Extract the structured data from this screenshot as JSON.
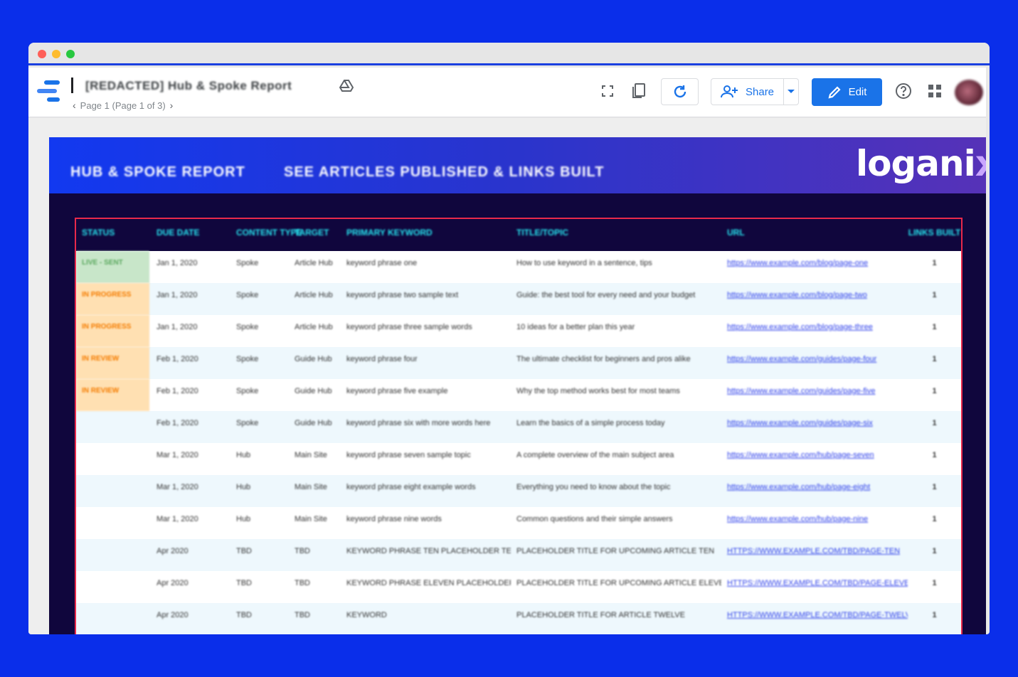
{
  "window": {
    "doc_title": "[REDACTED] Hub & Spoke Report",
    "page_indicator": "Page 1 (Page 1 of 3)"
  },
  "toolbar": {
    "share_label": "Share",
    "edit_label": "Edit"
  },
  "icons": {
    "app_logo": "data-studio-logo",
    "drive": "google-drive-icon",
    "fullscreen": "fullscreen-icon",
    "copy": "copy-icon",
    "refresh": "refresh-icon",
    "share": "person-add-icon",
    "share_dropdown": "caret-down-icon",
    "edit": "pencil-icon",
    "help": "help-icon",
    "apps": "apps-grid-icon"
  },
  "colors": {
    "accent": "#1a73e8",
    "report_bg": "#10063d",
    "header_cyan": "#27e6f0",
    "table_border": "#e8294b",
    "status_green": "#c8e6c9",
    "status_orange": "#ffe0b2"
  },
  "report": {
    "title": "HUB & SPOKE REPORT",
    "subtitle": "SEE ARTICLES PUBLISHED & LINKS BUILT",
    "brand_main": "logani",
    "brand_x": "x",
    "columns": [
      "STATUS",
      "DUE DATE",
      "CONTENT TYPE",
      "TARGET",
      "PRIMARY KEYWORD",
      "TITLE/TOPIC",
      "URL",
      "LINKS BUILT"
    ],
    "rows": [
      {
        "status": "LIVE - SENT",
        "status_type": "green",
        "date": "Jan 1, 2020",
        "type": "Spoke",
        "target": "Article Hub",
        "keyword": "keyword phrase one",
        "title": "How to use keyword in a sentence, tips",
        "url": "https://www.example.com/blog/page-one",
        "links": "1"
      },
      {
        "status": "IN PROGRESS",
        "status_type": "orange",
        "date": "Jan 1, 2020",
        "type": "Spoke",
        "target": "Article Hub",
        "keyword": "keyword phrase two sample text",
        "title": "Guide: the best tool for every need and your budget",
        "url": "https://www.example.com/blog/page-two",
        "links": "1"
      },
      {
        "status": "IN PROGRESS",
        "status_type": "orange",
        "date": "Jan 1, 2020",
        "type": "Spoke",
        "target": "Article Hub",
        "keyword": "keyword phrase three sample words",
        "title": "10 ideas for a better plan this year",
        "url": "https://www.example.com/blog/page-three",
        "links": "1"
      },
      {
        "status": "IN REVIEW",
        "status_type": "orange",
        "date": "Feb 1, 2020",
        "type": "Spoke",
        "target": "Guide Hub",
        "keyword": "keyword phrase four",
        "title": "The ultimate checklist for beginners and pros alike",
        "url": "https://www.example.com/guides/page-four",
        "links": "1"
      },
      {
        "status": "IN REVIEW",
        "status_type": "orange",
        "date": "Feb 1, 2020",
        "type": "Spoke",
        "target": "Guide Hub",
        "keyword": "keyword phrase five example",
        "title": "Why the top method works best for most teams",
        "url": "https://www.example.com/guides/page-five",
        "links": "1"
      },
      {
        "status": "",
        "status_type": "none",
        "date": "Feb 1, 2020",
        "type": "Spoke",
        "target": "Guide Hub",
        "keyword": "keyword phrase six with more words here",
        "title": "Learn the basics of a simple process today",
        "url": "https://www.example.com/guides/page-six",
        "links": "1"
      },
      {
        "status": "",
        "status_type": "none",
        "date": "Mar 1, 2020",
        "type": "Hub",
        "target": "Main Site",
        "keyword": "keyword phrase seven sample topic",
        "title": "A complete overview of the main subject area",
        "url": "https://www.example.com/hub/page-seven",
        "links": "1"
      },
      {
        "status": "",
        "status_type": "none",
        "date": "Mar 1, 2020",
        "type": "Hub",
        "target": "Main Site",
        "keyword": "keyword phrase eight example words",
        "title": "Everything you need to know about the topic",
        "url": "https://www.example.com/hub/page-eight",
        "links": "1"
      },
      {
        "status": "",
        "status_type": "none",
        "date": "Mar 1, 2020",
        "type": "Hub",
        "target": "Main Site",
        "keyword": "keyword phrase nine words",
        "title": "Common questions and their simple answers",
        "url": "https://www.example.com/hub/page-nine",
        "links": "1"
      },
      {
        "status": "",
        "status_type": "none",
        "date": "Apr 2020",
        "type": "TBD",
        "target": "TBD",
        "keyword": "KEYWORD PHRASE TEN PLACEHOLDER TEXT",
        "title": "PLACEHOLDER TITLE FOR UPCOMING ARTICLE TEN",
        "url": "HTTPS://WWW.EXAMPLE.COM/TBD/PAGE-TEN",
        "links": "1"
      },
      {
        "status": "",
        "status_type": "none",
        "date": "Apr 2020",
        "type": "TBD",
        "target": "TBD",
        "keyword": "KEYWORD PHRASE ELEVEN PLACEHOLDER",
        "title": "PLACEHOLDER TITLE FOR UPCOMING ARTICLE ELEVEN",
        "url": "HTTPS://WWW.EXAMPLE.COM/TBD/PAGE-ELEVEN",
        "links": "1"
      },
      {
        "status": "",
        "status_type": "none",
        "date": "Apr 2020",
        "type": "TBD",
        "target": "TBD",
        "keyword": "KEYWORD",
        "title": "PLACEHOLDER TITLE FOR ARTICLE TWELVE",
        "url": "HTTPS://WWW.EXAMPLE.COM/TBD/PAGE-TWELVE",
        "links": "1"
      }
    ]
  }
}
